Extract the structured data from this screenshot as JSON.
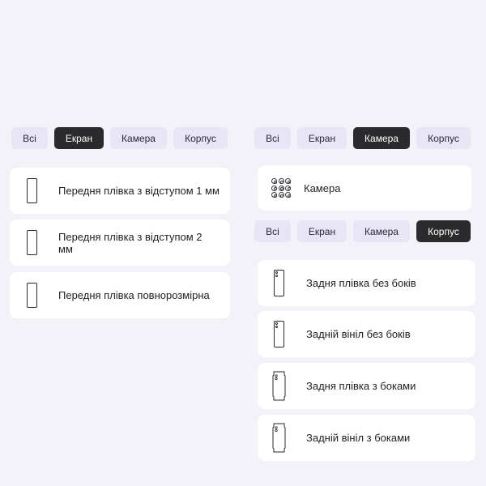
{
  "left_panel": {
    "tabs": [
      "Всі",
      "Екран",
      "Камера",
      "Корпус"
    ],
    "active_tab": "Екран",
    "items": [
      {
        "label": "Передня плівка з відступом 1 мм",
        "icon": "phone-front-icon"
      },
      {
        "label": "Передня плівка з відступом 2 мм",
        "icon": "phone-front-icon"
      },
      {
        "label": "Передня плівка повнорозмірна",
        "icon": "phone-front-icon"
      }
    ]
  },
  "camera_panel": {
    "tabs": [
      "Всі",
      "Екран",
      "Камера",
      "Корпус"
    ],
    "active_tab": "Камера",
    "items": [
      {
        "label": "Камера",
        "icon": "camera-lenses-icon"
      }
    ]
  },
  "body_panel": {
    "tabs": [
      "Всі",
      "Екран",
      "Камера",
      "Корпус"
    ],
    "active_tab": "Корпус",
    "items": [
      {
        "label": "Задня плівка без боків",
        "icon": "phone-back-icon"
      },
      {
        "label": "Задній вініл без боків",
        "icon": "phone-back-icon"
      },
      {
        "label": "Задня плівка з боками",
        "icon": "phone-back-sides-icon"
      },
      {
        "label": "Задній вініл з боками",
        "icon": "phone-back-sides-icon"
      }
    ]
  },
  "colors": {
    "background": "#f3f2f8",
    "tab_bg": "#e8e5f7",
    "tab_active_bg": "#2b2b2d",
    "card_bg": "#ffffff"
  }
}
